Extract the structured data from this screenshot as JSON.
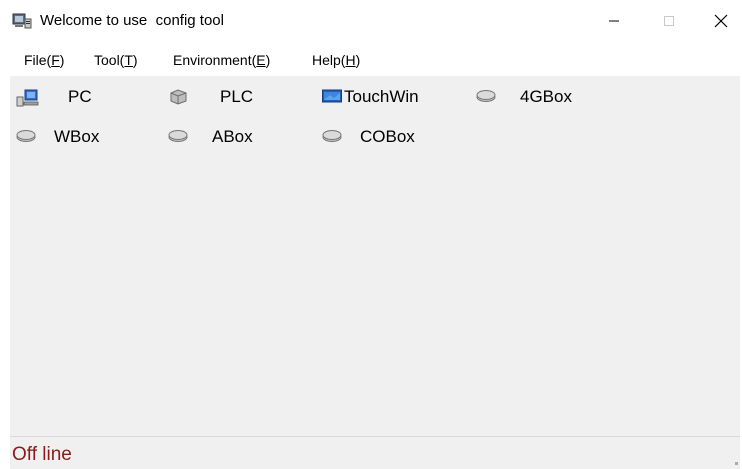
{
  "window": {
    "title": "Welcome to use  config tool",
    "controls": {
      "minimize": "—",
      "maximize": "☐",
      "close": "✕"
    }
  },
  "menu": {
    "items": [
      {
        "text": "File(",
        "key": "F",
        "end": ")"
      },
      {
        "text": "Tool(",
        "key": "T",
        "end": ")"
      },
      {
        "text": "Environment(",
        "key": "E",
        "end": ")"
      },
      {
        "text": "Help(",
        "key": "H",
        "end": ")"
      }
    ]
  },
  "devices": [
    {
      "label": "PC",
      "icon": "pc-icon"
    },
    {
      "label": "PLC",
      "icon": "plc-icon"
    },
    {
      "label": "TouchWin",
      "icon": "touchwin-icon"
    },
    {
      "label": "4GBox",
      "icon": "box-icon"
    },
    {
      "label": "WBox",
      "icon": "box-icon"
    },
    {
      "label": "ABox",
      "icon": "box-icon"
    },
    {
      "label": "COBox",
      "icon": "box-icon"
    }
  ],
  "status": {
    "text": "Off line",
    "color": "#8b1a1a"
  }
}
